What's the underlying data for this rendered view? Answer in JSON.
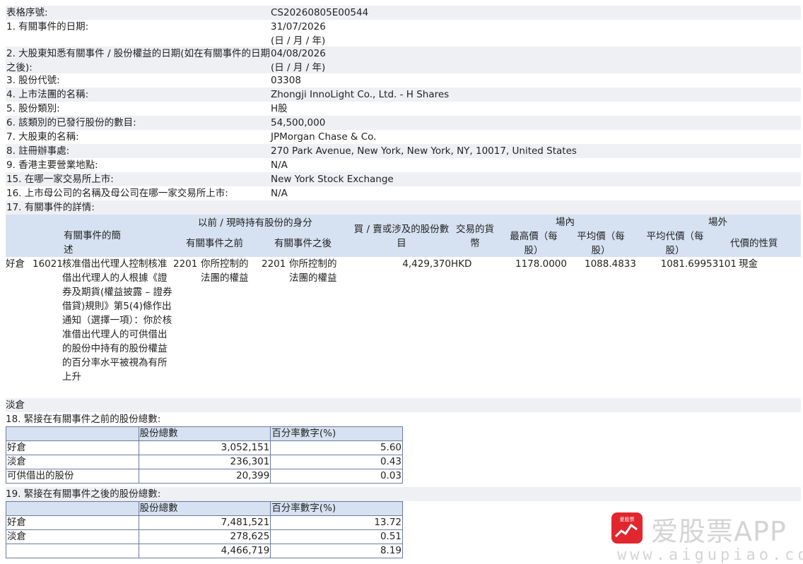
{
  "fields": [
    {
      "label": "表格序號:",
      "value": "CS20260805E00544",
      "sub": ""
    },
    {
      "label": "1. 有關事件的日期:",
      "value": "31/07/2026",
      "sub": "(日 / 月 / 年)"
    },
    {
      "label": "2. 大股東知悉有關事件 / 股份權益的日期(如在有關事件的日期之後):",
      "value": "04/08/2026",
      "sub": "(日 / 月 / 年)"
    },
    {
      "label": "3. 股份代號:",
      "value": "03308",
      "sub": ""
    },
    {
      "label": "4. 上市法團的名稱:",
      "value": "Zhongji InnoLight Co., Ltd. - H Shares",
      "sub": ""
    },
    {
      "label": "5. 股份類別:",
      "value": "H股",
      "sub": ""
    },
    {
      "label": "6. 該類別的已發行股份的數目:",
      "value": "54,500,000",
      "sub": ""
    },
    {
      "label": "7. 大股東的名稱:",
      "value": "JPMorgan Chase & Co.",
      "sub": ""
    },
    {
      "label": "8. 註冊辦事處:",
      "value": "270 Park Avenue, New York, New York, NY, 10017, United States",
      "sub": ""
    },
    {
      "label": "9. 香港主要營業地點:",
      "value": "N/A",
      "sub": ""
    },
    {
      "label": "15. 在哪一家交易所上市:",
      "value": "New York Stock Exchange",
      "sub": ""
    },
    {
      "label": "16. 上市母公司的名稱及母公司在哪一家交易所上市:",
      "value": "N/A",
      "sub": ""
    },
    {
      "label": "17. 有關事件的詳情:",
      "value": "",
      "sub": ""
    }
  ],
  "event_table": {
    "headers": {
      "brief": "有關事件的簡述",
      "capacity_group": "以前 / 現時持有股份的身分",
      "before": "有關事件之前",
      "after": "有關事件之後",
      "shares": "買 / 賣或涉及的股份數目",
      "currency": "交易的貨幣",
      "onmarket": "場內",
      "high": "最高價（每股）",
      "avg": "平均價（每股）",
      "offmarket": "場外",
      "avg_consideration": "平均代價（每股）",
      "nature": "代價的性質"
    },
    "row": {
      "position": "好倉",
      "code": "16021",
      "description": "核准借出代理人控制核准借出代理人的人根據《證券及期貨(權益披露 – 證券借貸)規則》第5(4)條作出通知（選擇一項）：你於核准借出代理人的可供借出的股份中持有的股份權益的百分率水平被視為有所上升",
      "before_code": "2201",
      "before_capacity": "你所控制的法團的權益",
      "after_code": "2201",
      "after_capacity": "你所控制的法團的權益",
      "shares": "4,429,370",
      "currency": "HKD",
      "high": "1178.0000",
      "avg": "1088.4833",
      "avg_consideration": "1081.69953101",
      "nature": "現金"
    },
    "short_label": "淡倉"
  },
  "section18": {
    "title": "18. 緊接在有關事件之前的股份總數:",
    "col_shares": "股份總數",
    "col_pct": "百分率數字(%)",
    "rows": [
      {
        "label": "好倉",
        "shares": "3,052,151",
        "pct": "5.60"
      },
      {
        "label": "淡倉",
        "shares": "236,301",
        "pct": "0.43"
      },
      {
        "label": "可供借出的股份",
        "shares": "20,399",
        "pct": "0.03"
      }
    ]
  },
  "section19": {
    "title": "19. 緊接在有關事件之後的股份總數:",
    "col_shares": "股份總數",
    "col_pct": "百分率數字(%)",
    "rows": [
      {
        "label": "好倉",
        "shares": "7,481,521",
        "pct": "13.72"
      },
      {
        "label": "淡倉",
        "shares": "278,625",
        "pct": "0.51"
      },
      {
        "label": "",
        "shares": "4,466,719",
        "pct": "8.19"
      }
    ]
  },
  "watermark": {
    "brand": "爱股票APP",
    "url": "www.aigupiao.com",
    "icon_label": "爱股票"
  },
  "colors": {
    "header_bg": "#d6e2f1",
    "row_shade": "#eef0f4",
    "logo_red": "#e2262d"
  }
}
